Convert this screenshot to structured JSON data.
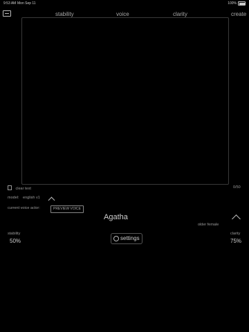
{
  "status": {
    "time": "9:53 AM",
    "date": "Mon Sep 11",
    "battery": "100%"
  },
  "nav": {
    "stability": "stability",
    "voice": "voice",
    "clarity": "clarity",
    "create": "create"
  },
  "editor": {
    "clear_label": "clear text",
    "char_count": "0/50"
  },
  "model": {
    "label": "model:",
    "value": "english v1"
  },
  "actor": {
    "label": "current voice actor:",
    "preview_label": "PREVIEW VOICE"
  },
  "voice": {
    "name": "Agatha",
    "descriptor": "older female"
  },
  "settings": {
    "label": "settings"
  },
  "stability": {
    "label": "stability",
    "value": "50%"
  },
  "clarity": {
    "label": "clarity",
    "value": "75%"
  },
  "icons": [
    "menu-icon",
    "battery-icon",
    "trash-icon",
    "chevron-up-icon",
    "gear-icon"
  ]
}
